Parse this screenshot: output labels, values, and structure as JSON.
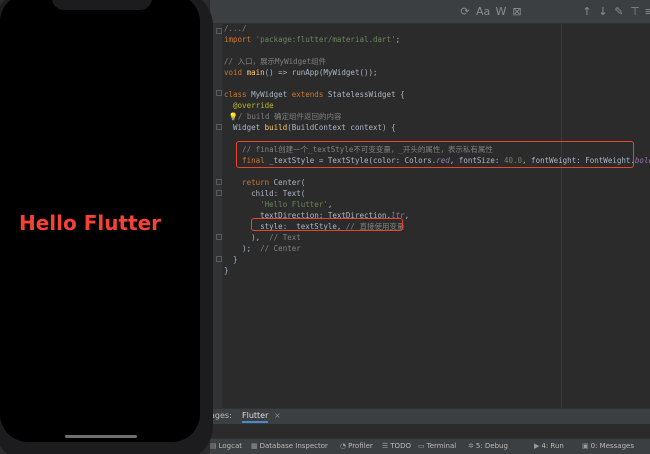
{
  "editor": {
    "toolbar": {
      "case": "Aa",
      "word": "W"
    },
    "lines": [
      {
        "parts": [
          [
            "cm",
            "/.../"
          ]
        ]
      },
      {
        "parts": [
          [
            "kw",
            "import "
          ],
          [
            "str",
            "'package:flutter/material.dart'"
          ],
          [
            "",
            ";"
          ]
        ]
      },
      {
        "parts": []
      },
      {
        "parts": [
          [
            "cm",
            "// 入口，展示MyWidget组件"
          ]
        ]
      },
      {
        "parts": [
          [
            "kw",
            "void "
          ],
          [
            "fn",
            "main"
          ],
          [
            "",
            "() => runApp(MyWidget());"
          ]
        ]
      },
      {
        "parts": []
      },
      {
        "parts": [
          [
            "kw",
            "class "
          ],
          [
            "",
            "MyWidget "
          ],
          [
            "kw",
            "extends "
          ],
          [
            "",
            "StatelessWidget {"
          ]
        ]
      },
      {
        "parts": [
          [
            "an",
            "  @override"
          ]
        ]
      },
      {
        "parts": [
          [
            "bulb",
            " 💡"
          ],
          [
            "cm",
            "/ build 确定组件返回的内容"
          ]
        ]
      },
      {
        "parts": [
          [
            "",
            "  Widget "
          ],
          [
            "fn",
            "build"
          ],
          [
            "",
            "(BuildContext context) {"
          ]
        ]
      },
      {
        "parts": []
      },
      {
        "parts": [
          [
            "cm",
            "    // final创建一个_textStyle不可变变量，_开头的属性，表示私有属性"
          ]
        ]
      },
      {
        "parts": [
          [
            "kw",
            "    final "
          ],
          [
            "",
            "_textStyle = TextStyle(color: Colors."
          ],
          [
            "it",
            "red"
          ],
          [
            "",
            ", fontSize: "
          ],
          [
            "str",
            "40.0"
          ],
          [
            "",
            ", fontWeight: FontWeight."
          ],
          [
            "it",
            "bold"
          ],
          [
            "",
            ");"
          ]
        ]
      },
      {
        "parts": []
      },
      {
        "parts": [
          [
            "kw",
            "    return "
          ],
          [
            "",
            "Center("
          ]
        ]
      },
      {
        "parts": [
          [
            "",
            "      child: Text("
          ]
        ]
      },
      {
        "parts": [
          [
            "str",
            "        'Hello Flutter'"
          ],
          [
            "",
            ","
          ]
        ]
      },
      {
        "parts": [
          [
            "",
            "        textDirection: TextDirection."
          ],
          [
            "it",
            "ltr"
          ],
          [
            "",
            ","
          ]
        ]
      },
      {
        "parts": [
          [
            "",
            "        style: _textStyle, "
          ],
          [
            "cm",
            "// 直接使用变量"
          ]
        ]
      },
      {
        "parts": [
          [
            "",
            "      ), "
          ],
          [
            "cm",
            " // Text"
          ]
        ]
      },
      {
        "parts": [
          [
            "",
            "    ); "
          ],
          [
            "cm",
            " // Center"
          ]
        ]
      },
      {
        "parts": [
          [
            "",
            "  }"
          ]
        ]
      },
      {
        "parts": [
          [
            "",
            "}"
          ]
        ]
      }
    ]
  },
  "tool_window": {
    "label": "ages:",
    "tab": "Flutter",
    "tab_close": "×"
  },
  "status_bar": {
    "items": [
      {
        "icon": "logcat-icon",
        "label": "Logcat"
      },
      {
        "icon": "database-icon",
        "label": "Database Inspector"
      },
      {
        "icon": "profiler-icon",
        "label": "Profiler"
      },
      {
        "icon": "todo-icon",
        "label": "TODO"
      },
      {
        "icon": "terminal-icon",
        "label": "Terminal"
      },
      {
        "icon": "debug-icon",
        "label": "5: Debug"
      },
      {
        "icon": "run-icon",
        "label": "4: Run"
      },
      {
        "icon": "messages-icon",
        "label": "0: Messages"
      }
    ]
  },
  "phone": {
    "text": "Hello Flutter",
    "text_color": "#f44336"
  }
}
